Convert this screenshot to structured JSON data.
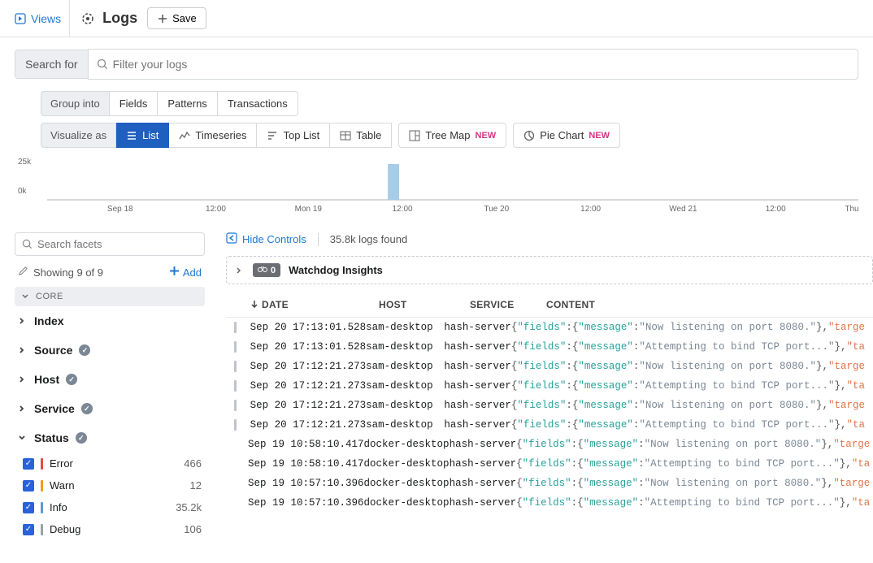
{
  "topbar": {
    "views": "Views",
    "title": "Logs",
    "save": "Save"
  },
  "search": {
    "label": "Search for",
    "placeholder": "Filter your logs"
  },
  "group": {
    "label": "Group into",
    "fields": "Fields",
    "patterns": "Patterns",
    "transactions": "Transactions"
  },
  "viz": {
    "label": "Visualize as",
    "list": "List",
    "timeseries": "Timeseries",
    "toplist": "Top List",
    "table": "Table",
    "treemap": "Tree Map",
    "piechart": "Pie Chart",
    "new": "NEW"
  },
  "chart_data": {
    "type": "bar",
    "ylabel_top": "25k",
    "ylabel_bottom": "0k",
    "ylim": [
      0,
      25000
    ],
    "xticks": [
      "Sep 18",
      "12:00",
      "Mon 19",
      "12:00",
      "Tue 20",
      "12:00",
      "Wed 21",
      "12:00",
      "Thu"
    ],
    "bars": [
      {
        "x_index": 3,
        "value": 25000
      }
    ]
  },
  "facets": {
    "search_placeholder": "Search facets",
    "showing": "Showing 9 of 9",
    "add": "Add",
    "core": "CORE",
    "groups": [
      {
        "label": "Index",
        "check": false
      },
      {
        "label": "Source",
        "check": true
      },
      {
        "label": "Host",
        "check": true
      },
      {
        "label": "Service",
        "check": true
      }
    ],
    "status_label": "Status",
    "status": [
      {
        "label": "Error",
        "count": "466",
        "color": "#e74c3c"
      },
      {
        "label": "Warn",
        "count": "12",
        "color": "#f39c12"
      },
      {
        "label": "Info",
        "count": "35.2k",
        "color": "#5b9bd5"
      },
      {
        "label": "Debug",
        "count": "106",
        "color": "#95a5a6"
      }
    ]
  },
  "right": {
    "hide": "Hide Controls",
    "found": "35.8k logs found",
    "watchdog_count": "0",
    "watchdog": "Watchdog Insights"
  },
  "table": {
    "headers": {
      "date": "DATE",
      "host": "HOST",
      "service": "SERVICE",
      "content": "CONTENT"
    },
    "rows": [
      {
        "date": "Sep 20 17:13:01.528",
        "host": "sam-desktop",
        "svc": "hash-server",
        "msg": "Now listening on port 8080.",
        "trail": "targe"
      },
      {
        "date": "Sep 20 17:13:01.528",
        "host": "sam-desktop",
        "svc": "hash-server",
        "msg": "Attempting to bind TCP port...",
        "trail": "ta"
      },
      {
        "date": "Sep 20 17:12:21.273",
        "host": "sam-desktop",
        "svc": "hash-server",
        "msg": "Now listening on port 8080.",
        "trail": "targe"
      },
      {
        "date": "Sep 20 17:12:21.273",
        "host": "sam-desktop",
        "svc": "hash-server",
        "msg": "Attempting to bind TCP port...",
        "trail": "ta"
      },
      {
        "date": "Sep 20 17:12:21.273",
        "host": "sam-desktop",
        "svc": "hash-server",
        "msg": "Now listening on port 8080.",
        "trail": "targe"
      },
      {
        "date": "Sep 20 17:12:21.273",
        "host": "sam-desktop",
        "svc": "hash-server",
        "msg": "Attempting to bind TCP port...",
        "trail": "ta"
      },
      {
        "date": "Sep 19 10:58:10.417",
        "host": "docker-desktop",
        "svc": "hash-server",
        "msg": "Now listening on port 8080.",
        "trail": "targe"
      },
      {
        "date": "Sep 19 10:58:10.417",
        "host": "docker-desktop",
        "svc": "hash-server",
        "msg": "Attempting to bind TCP port...",
        "trail": "ta"
      },
      {
        "date": "Sep 19 10:57:10.396",
        "host": "docker-desktop",
        "svc": "hash-server",
        "msg": "Now listening on port 8080.",
        "trail": "targe"
      },
      {
        "date": "Sep 19 10:57:10.396",
        "host": "docker-desktop",
        "svc": "hash-server",
        "msg": "Attempting to bind TCP port...",
        "trail": "ta"
      }
    ]
  }
}
